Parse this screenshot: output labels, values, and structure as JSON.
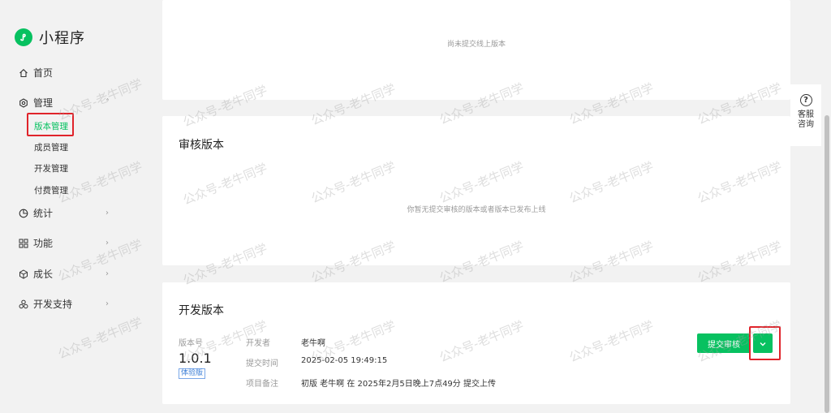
{
  "brand": {
    "name": "小程序",
    "logo_icon": "miniprogram-logo-icon"
  },
  "sidebar": {
    "items": [
      {
        "label": "首页",
        "icon": "home-icon"
      },
      {
        "label": "管理",
        "icon": "settings-icon"
      },
      {
        "label": "统计",
        "icon": "stats-icon"
      },
      {
        "label": "功能",
        "icon": "grid-icon"
      },
      {
        "label": "成长",
        "icon": "growth-icon"
      },
      {
        "label": "开发支持",
        "icon": "dev-support-icon"
      }
    ],
    "sub_items": [
      {
        "label": "版本管理",
        "active": true
      },
      {
        "label": "成员管理"
      },
      {
        "label": "开发管理"
      },
      {
        "label": "付费管理"
      }
    ]
  },
  "online_version": {
    "empty_text": "尚未提交线上版本"
  },
  "review_version": {
    "title": "审核版本",
    "empty_text": "你暂无提交审核的版本或者版本已发布上线"
  },
  "dev_version": {
    "title": "开发版本",
    "version_label": "版本号",
    "version_number": "1.0.1",
    "badge": "体验版",
    "developer_label": "开发者",
    "developer_value": "老牛啊",
    "submit_time_label": "提交时间",
    "submit_time_value": "2025-02-05 19:49:15",
    "note_label": "项目备注",
    "note_value": "初版 老牛啊 在 2025年2月5日晚上7点49分 提交上传",
    "submit_button": "提交审核"
  },
  "help_float": {
    "text": "客服咨询"
  },
  "watermark": "公众号-老牛同学",
  "colors": {
    "accent": "#07c160",
    "highlight_box": "#e0242b"
  }
}
